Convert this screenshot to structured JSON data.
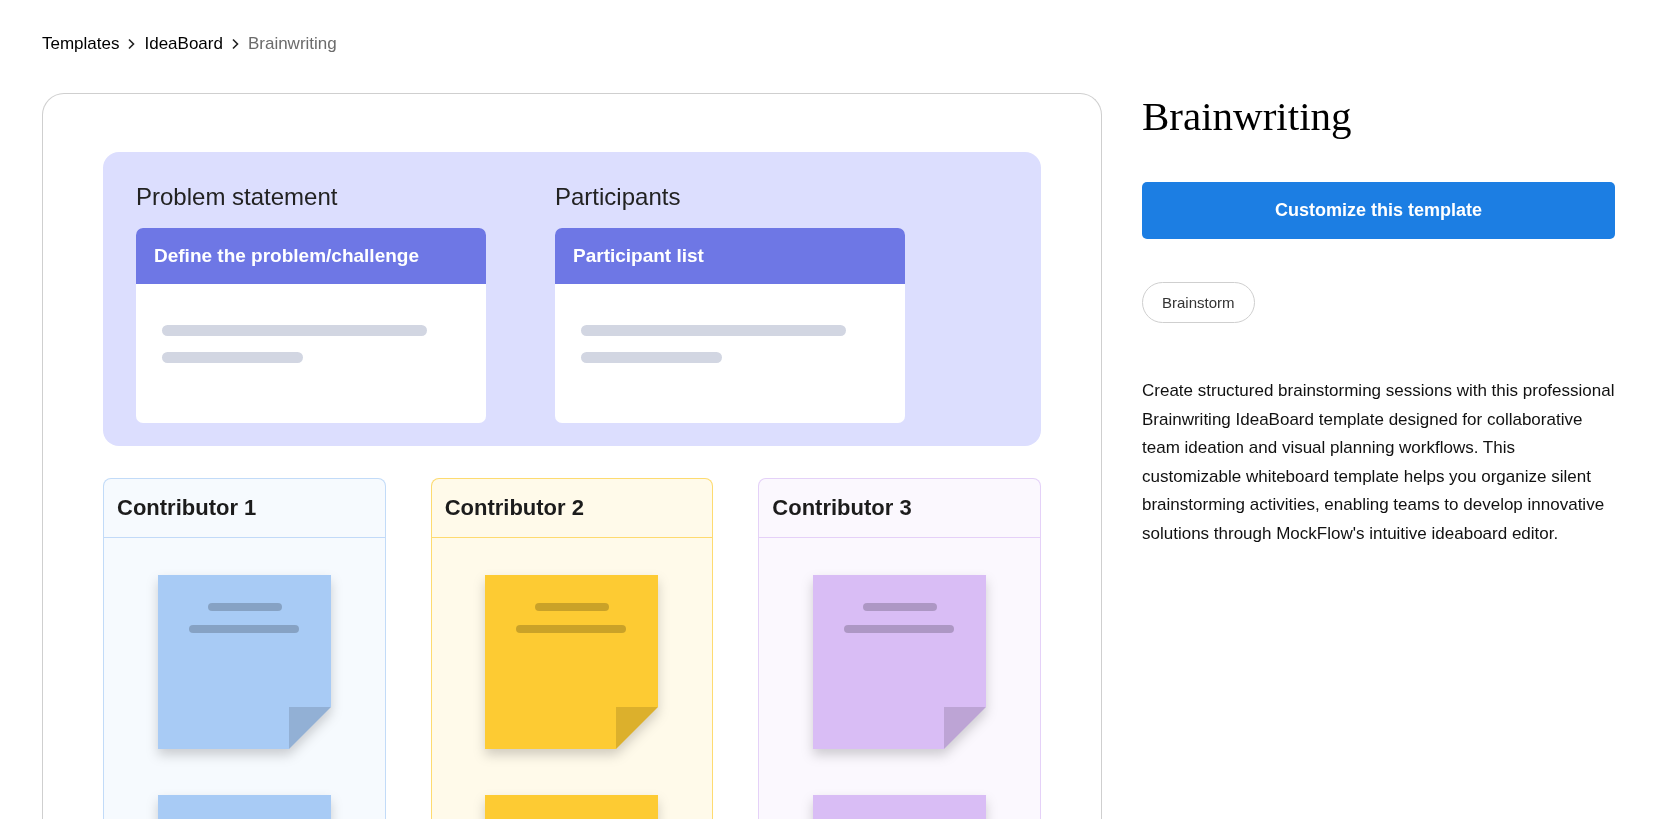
{
  "breadcrumb": [
    {
      "label": "Templates",
      "current": false
    },
    {
      "label": "IdeaBoard",
      "current": false
    },
    {
      "label": "Brainwriting",
      "current": true
    }
  ],
  "preview": {
    "top_sections": [
      {
        "heading": "Problem statement",
        "card_title": "Define the problem/challenge"
      },
      {
        "heading": "Participants",
        "card_title": "Participant list"
      }
    ],
    "contributors": [
      {
        "title": "Contributor 1",
        "color": "#a8cbf5"
      },
      {
        "title": "Contributor 2",
        "color": "#fdcb33"
      },
      {
        "title": "Contributor 3",
        "color": "#d9bdf5"
      }
    ]
  },
  "title": "Brainwriting",
  "primary_button": "Customize this template",
  "tags": [
    "Brainstorm"
  ],
  "description": "Create structured brainstorming sessions with this professional Brainwriting IdeaBoard template designed for collaborative team ideation and visual planning workflows. This customizable whiteboard template helps you organize silent brainstorming activities, enabling teams to develop innovative solutions through MockFlow's intuitive ideaboard editor."
}
